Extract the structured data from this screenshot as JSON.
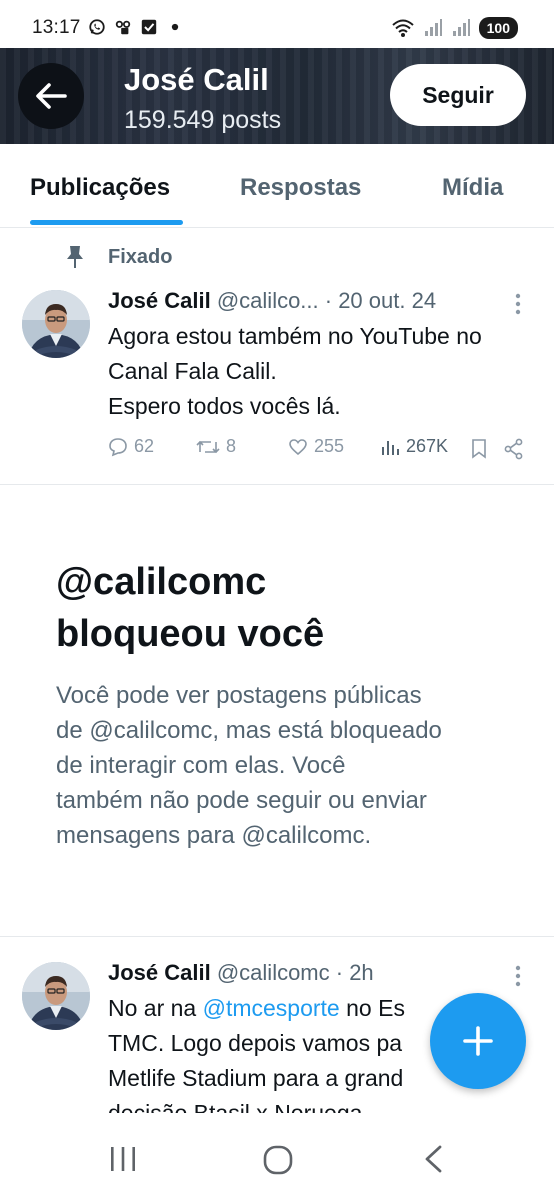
{
  "status_bar": {
    "time": "13:17",
    "battery": "100"
  },
  "header": {
    "name": "José Calil",
    "posts": "159.549 posts",
    "follow_label": "Seguir"
  },
  "tabs": [
    {
      "label": "Publicações",
      "active": true
    },
    {
      "label": "Respostas",
      "active": false
    },
    {
      "label": "Mídia",
      "active": false
    }
  ],
  "pinned_tweet": {
    "pinned_label": "Fixado",
    "author": "José Calil",
    "handle_date": "@calilco... · 20 out. 24",
    "lines": [
      "Agora estou também no YouTube no",
      "Canal Fala Calil.",
      "Espero todos vocês lá."
    ],
    "replies": "62",
    "retweets": "8",
    "likes": "255",
    "views": "267K"
  },
  "blocked": {
    "title_line1": "@calilcomc",
    "title_line2": "bloqueou você",
    "desc_lines": [
      "Você pode ver postagens públicas",
      "de @calilcomc, mas está bloqueado",
      "de interagir com elas. Você",
      "também não pode seguir ou enviar",
      "mensagens para @calilcomc."
    ]
  },
  "second_tweet": {
    "author": "José Calil",
    "handle_date": "@calilcomc · 2h",
    "line1_prefix": "No ar na ",
    "line1_mention": "@tmcesporte",
    "line1_suffix": " no Es",
    "line2": "TMC. Logo depois vamos pa",
    "line3": "Metlife Stadium para a grand",
    "line4": "decisão Btasil x Noruega."
  },
  "colors": {
    "accent": "#1d9bf0",
    "text": "#0f1419",
    "muted": "#536471"
  }
}
